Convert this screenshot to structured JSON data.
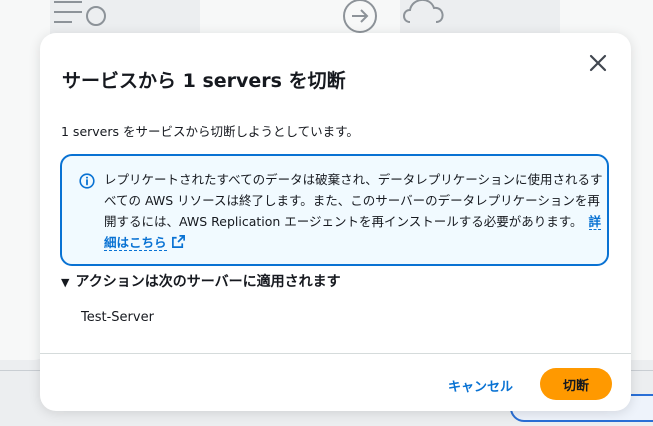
{
  "modal": {
    "title": "サービスから 1 servers を切断",
    "description": "1 servers をサービスから切断しようとしています。",
    "alert": {
      "text": "レプリケートされたすべてのデータは破棄され、データレプリケーションに使用されるすべての AWS リソースは終了します。また、このサーバーのデータレプリケーションを再開するには、AWS Replication エージェントを再インストールする必要があります。",
      "link_label": "詳細はこちら",
      "icon": "info-icon",
      "link_icon": "external-link-icon"
    },
    "expander": {
      "label": "アクションは次のサーバーに適用されます",
      "expanded": true
    },
    "servers": [
      "Test-Server"
    ],
    "buttons": {
      "cancel": "キャンセル",
      "confirm": "切断"
    }
  },
  "colors": {
    "primary": "#ff9900",
    "link": "#0972d3",
    "alert_border": "#0972d3",
    "alert_background": "#f1faff"
  }
}
